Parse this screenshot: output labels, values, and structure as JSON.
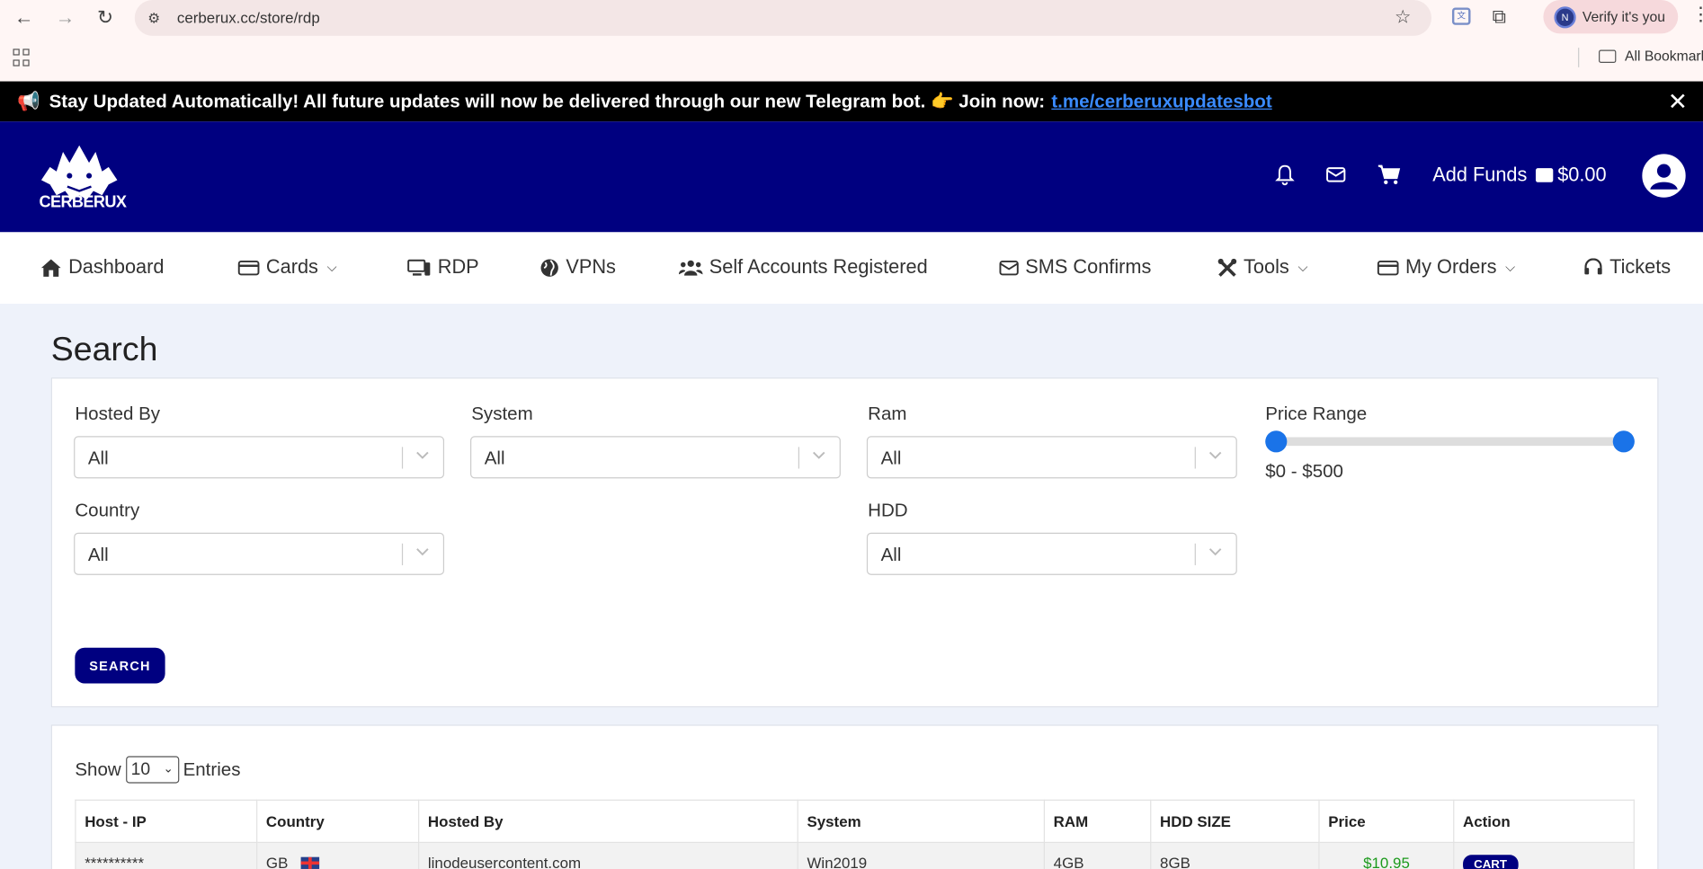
{
  "browser": {
    "url": "cerberux.cc/store/rdp",
    "verify_label": "Verify it's you",
    "profile_initial": "N",
    "bookmarks_label": "All Bookmarks"
  },
  "announcement": {
    "text": "Stay Updated Automatically! All future updates will now be delivered through our new Telegram bot. 👉 Join now:",
    "link": "t.me/cerberuxupdatesbot"
  },
  "header": {
    "brand": "CERBERUX",
    "add_funds": "Add Funds",
    "balance": "$0.00"
  },
  "nav": {
    "dashboard": "Dashboard",
    "cards": "Cards",
    "rdp": "RDP",
    "vpns": "VPNs",
    "self_accounts": "Self Accounts Registered",
    "sms": "SMS Confirms",
    "tools": "Tools",
    "orders": "My Orders",
    "tickets": "Tickets"
  },
  "search": {
    "title": "Search",
    "hosted_by": {
      "label": "Hosted By",
      "value": "All"
    },
    "system": {
      "label": "System",
      "value": "All"
    },
    "ram": {
      "label": "Ram",
      "value": "All"
    },
    "country": {
      "label": "Country",
      "value": "All"
    },
    "hdd": {
      "label": "HDD",
      "value": "All"
    },
    "price_range": {
      "label": "Price Range",
      "text": "$0 - $500",
      "min": 0,
      "max": 500
    },
    "button": "SEARCH"
  },
  "table": {
    "show_label": "Show",
    "entries_value": "10",
    "entries_label": "Entries",
    "headers": [
      "Host - IP",
      "Country",
      "Hosted By",
      "System",
      "RAM",
      "HDD SIZE",
      "Price",
      "Action"
    ],
    "rows": [
      {
        "host": "**********",
        "country": "GB",
        "hosted_by": "linodeusercontent.com",
        "system": "Win2019",
        "ram": "4GB",
        "hdd": "8GB",
        "price": "$10.95",
        "action": "CART"
      }
    ]
  },
  "colors": {
    "header_bg": "#000080",
    "accent": "#1a73e8",
    "price": "#1c9a1c"
  }
}
